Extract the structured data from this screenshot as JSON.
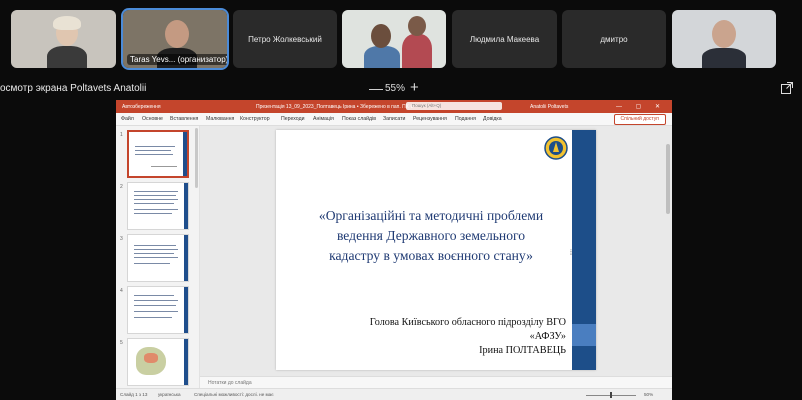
{
  "participants": [
    {
      "name": "",
      "label": ""
    },
    {
      "name": "",
      "label": "Taras Yevs... (организатор)"
    },
    {
      "name": "Петро Жолкевський",
      "label": ""
    },
    {
      "name": "",
      "label": ""
    },
    {
      "name": "Людмила Макеева",
      "label": ""
    },
    {
      "name": "дмитро",
      "label": ""
    },
    {
      "name": "",
      "label": ""
    }
  ],
  "share_bar": {
    "title": "осмотр экрана Poltavets Anatolii",
    "zoom_minus": "—",
    "zoom_value": "55%",
    "zoom_plus": "+"
  },
  "ppt": {
    "autosave": "Автозбереження",
    "doc_title": "Презентація 13_09_2023_Полтавець Ірина • Збережено в пап. ПК ∨",
    "search_placeholder": "Пошук (Alt+Q)",
    "user": "Anatolii Poltavets",
    "window_controls": "— ▢ ✕",
    "tabs": [
      "Файл",
      "Основне",
      "Вставлення",
      "Малювання",
      "Конструктор",
      "Переходи",
      "Анімація",
      "Показ слайдів",
      "Записати",
      "Рецензування",
      "Подання",
      "Довідка"
    ],
    "share_button": "Спільний доступ",
    "thumb_numbers": [
      "1",
      "2",
      "3",
      "4",
      "5"
    ],
    "slide": {
      "title_lines": [
        "«Організаційні та методичні проблеми",
        "ведення Державного земельного",
        "кадастру в умовах воєнного стану»"
      ],
      "author_lines": [
        "Голова Київського обласного підрозділу ВГО",
        "«АФЗУ»",
        "Ірина ПОЛТАВЕЦЬ"
      ]
    },
    "notes_placeholder": "Нотатки до слайда",
    "status": {
      "slide_info": "Слайд 1 з 13",
      "language": "українська",
      "accessibility": "Спеціальні можливості: дослі. не має",
      "zoom": "50%"
    }
  },
  "colors": {
    "ppt_accent": "#c4452c",
    "slide_blue": "#1d4e89",
    "title_text": "#1f3a73"
  }
}
